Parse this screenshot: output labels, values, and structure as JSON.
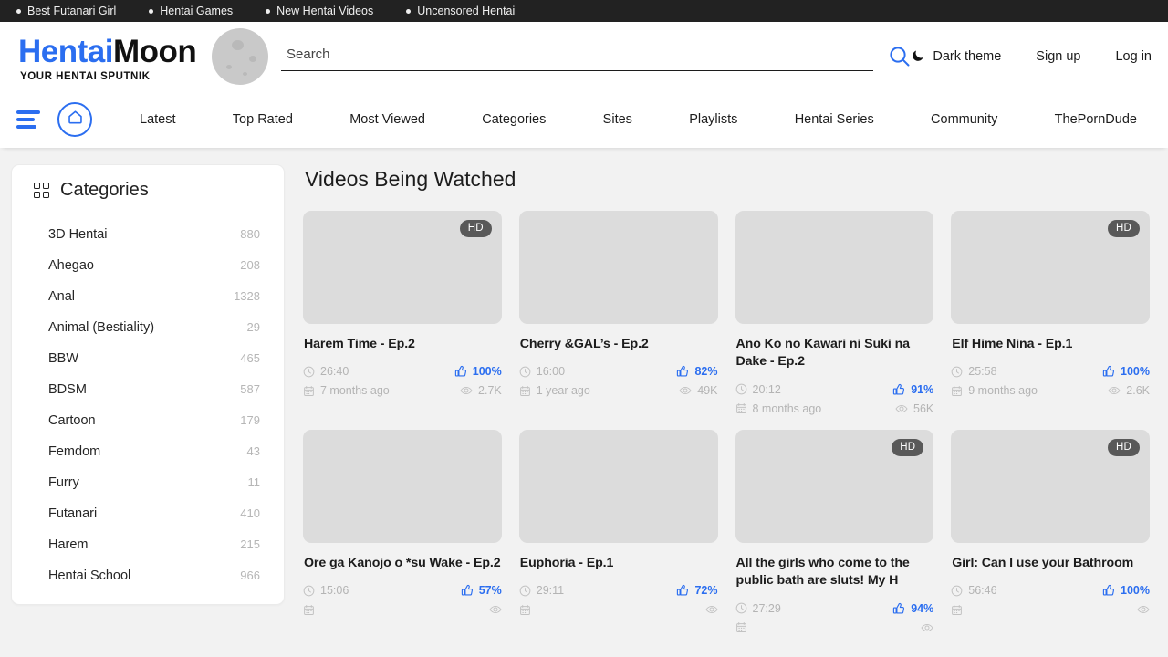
{
  "topbar": {
    "links": [
      "Best Futanari Girl",
      "Hentai Games",
      "New Hentai Videos",
      "Uncensored Hentai"
    ]
  },
  "header": {
    "logo_primary": "Hentai",
    "logo_secondary": "Moon",
    "logo_tagline": "YOUR HENTAI SPUTNIK",
    "search_placeholder": "Search",
    "search_value": "",
    "search_icon": "search-icon",
    "theme_label": "Dark theme",
    "theme_icon": "moon-icon",
    "signup_label": "Sign up",
    "login_label": "Log in"
  },
  "nav": {
    "menu_icon": "hamburger-icon",
    "home_icon": "home-icon",
    "links": [
      "Latest",
      "Top Rated",
      "Most Viewed",
      "Categories",
      "Sites",
      "Playlists",
      "Hentai Series",
      "Community",
      "ThePornDude"
    ]
  },
  "sidebar": {
    "title": "Categories",
    "icon": "grid-icon",
    "items": [
      {
        "label": "3D Hentai",
        "count": "880"
      },
      {
        "label": "Ahegao",
        "count": "208"
      },
      {
        "label": "Anal",
        "count": "1328"
      },
      {
        "label": "Animal (Bestiality)",
        "count": "29"
      },
      {
        "label": "BBW",
        "count": "465"
      },
      {
        "label": "BDSM",
        "count": "587"
      },
      {
        "label": "Cartoon",
        "count": "179"
      },
      {
        "label": "Femdom",
        "count": "43"
      },
      {
        "label": "Furry",
        "count": "11"
      },
      {
        "label": "Futanari",
        "count": "410"
      },
      {
        "label": "Harem",
        "count": "215"
      },
      {
        "label": "Hentai School",
        "count": "966"
      }
    ]
  },
  "main": {
    "section_title": "Videos Being Watched",
    "videos": [
      {
        "title": "Harem Time - Ep.2",
        "hd": true,
        "duration": "26:40",
        "rating": "100%",
        "date": "7 months ago",
        "views": "2.7K"
      },
      {
        "title": "Cherry &GAL’s - Ep.2",
        "hd": false,
        "duration": "16:00",
        "rating": "82%",
        "date": "1 year ago",
        "views": "49K"
      },
      {
        "title": "Ano Ko no Kawari ni Suki na Dake - Ep.2",
        "hd": false,
        "duration": "20:12",
        "rating": "91%",
        "date": "8 months ago",
        "views": "56K"
      },
      {
        "title": "Elf Hime Nina - Ep.1",
        "hd": true,
        "duration": "25:58",
        "rating": "100%",
        "date": "9 months ago",
        "views": "2.6K"
      },
      {
        "title": "Ore ga Kanojo o *su Wake - Ep.2",
        "hd": false,
        "duration": "15:06",
        "rating": "57%",
        "date": "",
        "views": ""
      },
      {
        "title": "Euphoria - Ep.1",
        "hd": false,
        "duration": "29:11",
        "rating": "72%",
        "date": "",
        "views": ""
      },
      {
        "title": "All the girls who come to the public bath are sluts! My H",
        "hd": true,
        "duration": "27:29",
        "rating": "94%",
        "date": "",
        "views": ""
      },
      {
        "title": "Girl: Can I use your Bathroom",
        "hd": true,
        "duration": "56:46",
        "rating": "100%",
        "date": "",
        "views": ""
      }
    ],
    "hd_label": "HD"
  },
  "colors": {
    "accent": "#2b6ef0",
    "topbar_bg": "#222222",
    "page_bg": "#f2f2f2",
    "thumb_placeholder": "#dcdcdc",
    "hd_badge_bg": "#595959",
    "muted_text": "#b4b4b4"
  }
}
